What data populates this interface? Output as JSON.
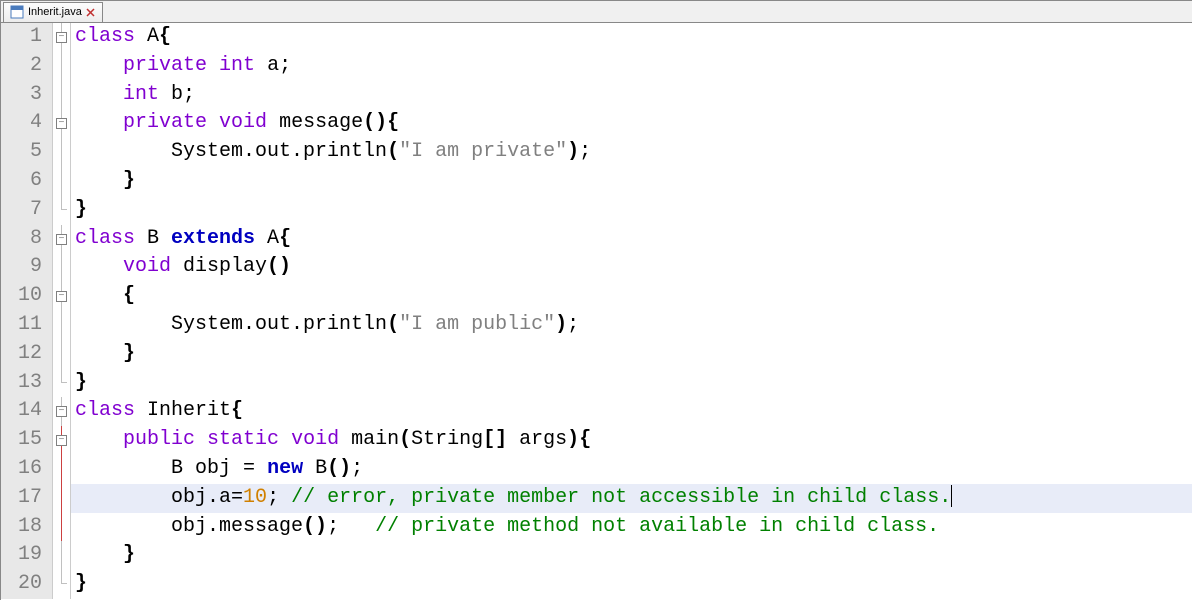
{
  "tab": {
    "filename": "Inherit.java"
  },
  "gutter": {
    "numbers": [
      "1",
      "2",
      "3",
      "4",
      "5",
      "6",
      "7",
      "8",
      "9",
      "10",
      "11",
      "12",
      "13",
      "14",
      "15",
      "16",
      "17",
      "18",
      "19",
      "20"
    ]
  },
  "code": {
    "l1": {
      "kw1": "class",
      "name": " A",
      "brace": "{"
    },
    "l2": {
      "indent": "    ",
      "kw1": "private",
      "sp1": " ",
      "kw2": "int",
      "rest": " a",
      "semi": ";"
    },
    "l3": {
      "indent": "    ",
      "kw1": "int",
      "rest": " b",
      "semi": ";"
    },
    "l4": {
      "indent": "    ",
      "kw1": "private",
      "sp1": " ",
      "kw2": "void",
      "name": " message",
      "paren": "()",
      "brace": "{"
    },
    "l5": {
      "indent": "        ",
      "call": "System.out.println",
      "paren1": "(",
      "str": "\"I am private\"",
      "paren2": ")",
      "semi": ";"
    },
    "l6": {
      "indent": "    ",
      "brace": "}"
    },
    "l7": {
      "brace": "}"
    },
    "l8": {
      "kw1": "class",
      "name": " B ",
      "kw2": "extends",
      "name2": " A",
      "brace": "{"
    },
    "l9": {
      "indent": "    ",
      "kw1": "void",
      "name": " display",
      "paren": "()"
    },
    "l10": {
      "indent": "    ",
      "brace": "{"
    },
    "l11": {
      "indent": "        ",
      "call": "System.out.println",
      "paren1": "(",
      "str": "\"I am public\"",
      "paren2": ")",
      "semi": ";"
    },
    "l12": {
      "indent": "    ",
      "brace": "}"
    },
    "l13": {
      "brace": "}"
    },
    "l14": {
      "kw1": "class",
      "name": " Inherit",
      "brace": "{"
    },
    "l15": {
      "indent": "    ",
      "kw1": "public",
      "sp1": " ",
      "kw2": "static",
      "sp2": " ",
      "kw3": "void",
      "name": " main",
      "paren1": "(",
      "argtype": "String",
      "arr": "[]",
      "argn": " args",
      "paren2": ")",
      "brace": "{"
    },
    "l16": {
      "indent": "        ",
      "type": "B",
      "name": " obj ",
      "eq": "=",
      "sp": " ",
      "kw": "new",
      "call": " B",
      "paren": "()",
      "semi": ";"
    },
    "l17": {
      "indent": "        ",
      "lhs": "obj.a",
      "eq": "=",
      "num": "10",
      "semi": ";",
      "sp": " ",
      "comment": "// error, private member not accessible in child class."
    },
    "l18": {
      "indent": "        ",
      "call": "obj.message",
      "paren": "()",
      "semi": ";",
      "sp": "   ",
      "comment": "// private method not available in child class."
    },
    "l19": {
      "indent": "    ",
      "brace": "}"
    },
    "l20": {
      "brace": "}"
    }
  },
  "highlighted_line": 17
}
